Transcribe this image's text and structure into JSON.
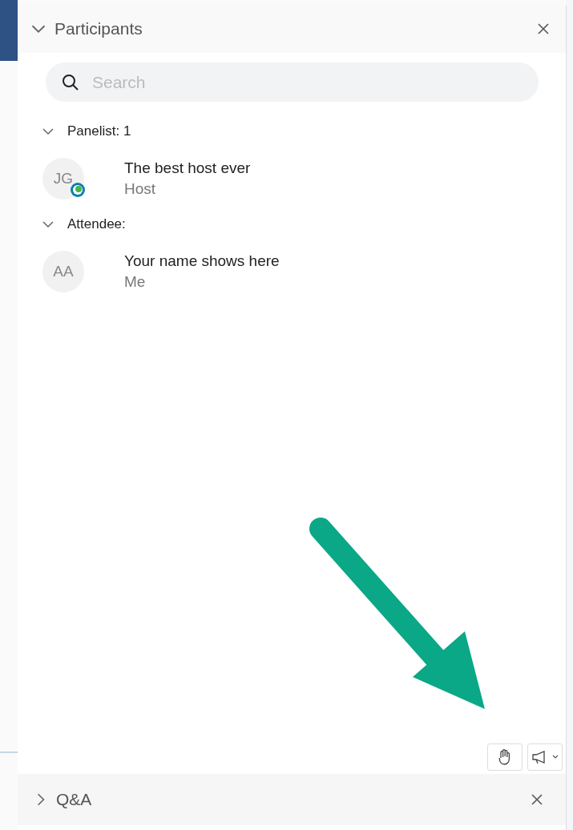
{
  "panel": {
    "title": "Participants",
    "expanded": true
  },
  "search": {
    "placeholder": "Search"
  },
  "groups": [
    {
      "label": "Panelist: 1",
      "expanded": true,
      "members": [
        {
          "initials": "JG",
          "name": "The best host ever",
          "role": "Host",
          "presenter_badge": true
        }
      ]
    },
    {
      "label": "Attendee:",
      "expanded": true,
      "members": [
        {
          "initials": "AA",
          "name": "Your name shows here",
          "role": "Me",
          "presenter_badge": false
        }
      ]
    }
  ],
  "qa_panel": {
    "title": "Q&A",
    "expanded": false
  }
}
